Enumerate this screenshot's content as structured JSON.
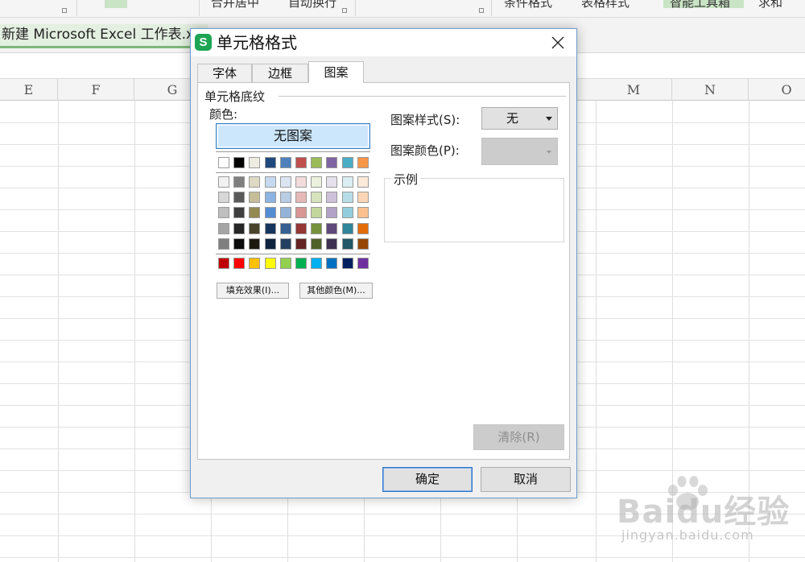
{
  "ribbon": {
    "labels": [
      "合并居中",
      "自动换行",
      "条件格式",
      "表格样式",
      "智能工具箱",
      "求和"
    ]
  },
  "document": {
    "tab_title": "新建 Microsoft Excel 工作表.xls"
  },
  "sheet": {
    "columns": [
      "E",
      "F",
      "G",
      "",
      "",
      "",
      "",
      "M",
      "N",
      "O"
    ]
  },
  "watermark": {
    "brand": "Baidu经验",
    "site": "jingyan.baidu.com"
  },
  "dialog": {
    "title": "单元格格式",
    "app_icon": "S",
    "tabs": [
      "字体",
      "边框",
      "图案"
    ],
    "active_tab": "图案",
    "group_label": "单元格底纹",
    "color_label": "颜色:",
    "no_pattern_label": "无图案",
    "fill_effects_label": "填充效果(I)...",
    "other_colors_label": "其他颜色(M)...",
    "pattern_style_label": "图案样式(S):",
    "pattern_style_value": "无",
    "pattern_color_label": "图案颜色(P):",
    "sample_label": "示例",
    "clear_label": "清除(R)",
    "ok_label": "确定",
    "cancel_label": "取消",
    "icons": {
      "close": "close-icon",
      "dropdown": "chevron-down-icon"
    }
  },
  "palette": {
    "theme_row": [
      "#ffffff",
      "#000000",
      "#eeece1",
      "#1f497d",
      "#4f81bd",
      "#c0504d",
      "#9bbb59",
      "#8064a2",
      "#4bacc6",
      "#f79646"
    ],
    "shade_rows": [
      [
        "#f2f2f2",
        "#7f7f7f",
        "#ddd9c3",
        "#c6d9f0",
        "#dbe5f1",
        "#f2dcdb",
        "#ebf1dd",
        "#e5e0ec",
        "#dbeef3",
        "#fdeada"
      ],
      [
        "#d8d8d8",
        "#595959",
        "#c4bd97",
        "#8db3e2",
        "#b8cce4",
        "#e5b9b7",
        "#d7e3bc",
        "#ccc1d9",
        "#b7dde8",
        "#fbd5b5"
      ],
      [
        "#bfbfbf",
        "#3f3f3f",
        "#938953",
        "#548dd4",
        "#95b3d7",
        "#d99694",
        "#c3d69b",
        "#b2a2c7",
        "#92cddc",
        "#fac08f"
      ],
      [
        "#a5a5a5",
        "#262626",
        "#494429",
        "#17365d",
        "#366092",
        "#953734",
        "#76923c",
        "#5f497a",
        "#31859b",
        "#e36c09"
      ],
      [
        "#7f7f7f",
        "#0c0c0c",
        "#1d1b10",
        "#0f243e",
        "#244061",
        "#632423",
        "#4f6128",
        "#3f3151",
        "#205867",
        "#974806"
      ]
    ],
    "standard_row": [
      "#c00000",
      "#ff0000",
      "#ffc000",
      "#ffff00",
      "#92d050",
      "#00b050",
      "#00b0f0",
      "#0070c0",
      "#002060",
      "#7030a0"
    ]
  },
  "colors": {
    "accent_blue": "#3b7fc4",
    "selected_fill": "#cce6fb",
    "wps_green": "#1da553"
  }
}
